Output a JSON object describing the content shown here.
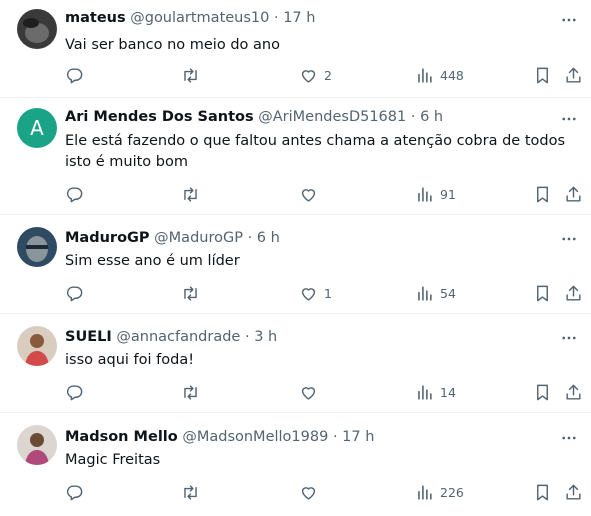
{
  "replies": [
    {
      "name": "mateus",
      "handle": "@goulartmateus10",
      "time": "17 h",
      "text": "Vai ser banco no meio do ano",
      "likes": "2",
      "views": "448",
      "avatar": {
        "type": "photo",
        "colors": [
          "#2e2e2e",
          "#6b6b6b"
        ]
      }
    },
    {
      "name": "Ari Mendes Dos Santos",
      "handle": "@AriMendesD51681",
      "time": "6 h",
      "text": "Ele está fazendo o que faltou antes chama a atenção cobra de todos isto é muito bom",
      "likes": "",
      "views": "91",
      "avatar": {
        "type": "letter",
        "letter": "A",
        "color": "#1aa386"
      }
    },
    {
      "name": "MaduroGP",
      "handle": "@MaduroGP",
      "time": "6 h",
      "text": "Sim esse ano é um líder",
      "likes": "1",
      "views": "54",
      "avatar": {
        "type": "photo",
        "colors": [
          "#2f4a63",
          "#9aa5ad"
        ]
      }
    },
    {
      "name": "SUELI",
      "handle": "@annacfandrade",
      "time": "3 h",
      "text": "isso aqui foi foda!",
      "likes": "",
      "views": "14",
      "avatar": {
        "type": "photo",
        "colors": [
          "#c9b8a8",
          "#d24a4a"
        ]
      }
    },
    {
      "name": "Madson Mello",
      "handle": "@MadsonMello1989",
      "time": "17 h",
      "text": "Magic Freitas",
      "likes": "",
      "views": "226",
      "avatar": {
        "type": "photo",
        "colors": [
          "#d8d2cc",
          "#b04a7a"
        ]
      }
    }
  ],
  "separator": "·",
  "icons": {
    "more": "more-options-icon",
    "reply": "reply-icon",
    "retweet": "retweet-icon",
    "like": "like-icon",
    "views": "views-icon",
    "bookmark": "bookmark-icon",
    "share": "share-icon"
  },
  "colors": {
    "text": "#0f1419",
    "muted": "#536471",
    "divider": "#eff3f4"
  }
}
